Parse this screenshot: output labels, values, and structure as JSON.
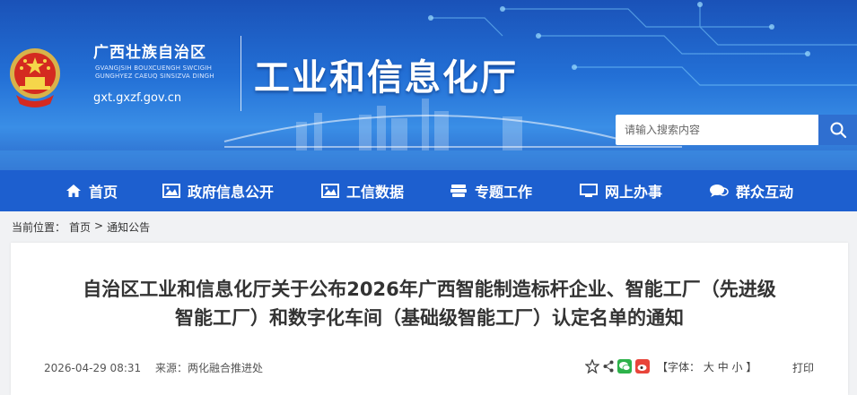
{
  "header": {
    "region_cn": "广西壮族自治区",
    "region_za_lines": [
      "GVANGJSIH BOUXCUENGH SWCIGIH",
      "GUNGHYEZ CAEUQ SINSIZVA DINGH"
    ],
    "domain": "gxt.gxzf.gov.cn",
    "department": "工业和信息化厅"
  },
  "search": {
    "placeholder": "请输入搜索内容"
  },
  "nav": {
    "items": [
      {
        "label": "首页",
        "icon": "home-icon"
      },
      {
        "label": "政府信息公开",
        "icon": "picture-icon"
      },
      {
        "label": "工信数据",
        "icon": "picture-icon"
      },
      {
        "label": "专题工作",
        "icon": "stack-icon"
      },
      {
        "label": "网上办事",
        "icon": "monitor-icon"
      },
      {
        "label": "群众互动",
        "icon": "chat-icon"
      }
    ]
  },
  "breadcrumb": {
    "prefix": "当前位置：",
    "home": "首页",
    "sep": ">",
    "current": "通知公告"
  },
  "article": {
    "title_line1": "自治区工业和信息化厅关于公布2026年广西智能制造标杆企业、智能工厂（先进级",
    "title_line2": "智能工厂）和数字化车间（基础级智能工厂）认定名单的通知",
    "date": "2026-04-29 08:31",
    "source": "来源：两化融合推进处",
    "font_label_open": "【字体：",
    "font_large": "大",
    "font_medium": "中",
    "font_small": "小",
    "font_label_close": "】",
    "print": "打印"
  },
  "colors": {
    "nav_bg": "#1d5fcf",
    "header_top": "#1a52b8",
    "search_btn": "#2f6fd0"
  }
}
